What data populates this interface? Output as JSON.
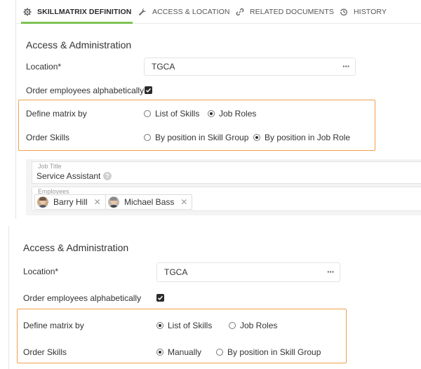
{
  "tabs": [
    {
      "label": "SKILLMATRIX DEFINITION",
      "icon": "gear-icon",
      "active": true
    },
    {
      "label": "ACCESS & LOCATION",
      "icon": "wrench-icon"
    },
    {
      "label": "RELATED DOCUMENTS",
      "icon": "link-icon"
    },
    {
      "label": "HISTORY",
      "icon": "history-icon"
    }
  ],
  "top": {
    "section_title": "Access & Administration",
    "location_label": "Location*",
    "location_value": "TGCA",
    "order_employees_label": "Order employees alphabetically",
    "order_employees_checked": true,
    "define_matrix_label": "Define matrix by",
    "define_matrix_options": [
      "List of Skills",
      "Job Roles"
    ],
    "define_matrix_selected": "Job Roles",
    "order_skills_label": "Order Skills",
    "order_skills_options": [
      "By position in Skill Group",
      "By position in Job Role"
    ],
    "order_skills_selected": "By position in Job Role",
    "job_title_caption": "Job Title",
    "job_title_value": "Service Assistant",
    "employees_caption": "Employees",
    "employees": [
      "Barry Hill",
      "Michael Bass"
    ]
  },
  "bottom": {
    "section_title": "Access & Administration",
    "location_label": "Location*",
    "location_value": "TGCA",
    "order_employees_label": "Order employees alphabetically",
    "order_employees_checked": true,
    "define_matrix_label": "Define matrix by",
    "define_matrix_options": [
      "List of Skills",
      "Job Roles"
    ],
    "define_matrix_selected": "List of Skills",
    "order_skills_label": "Order Skills",
    "order_skills_options": [
      "Manually",
      "By position in Skill Group"
    ],
    "order_skills_selected": "Manually"
  },
  "colors": {
    "accent": "#7cc254",
    "highlight": "#f0a04b"
  }
}
